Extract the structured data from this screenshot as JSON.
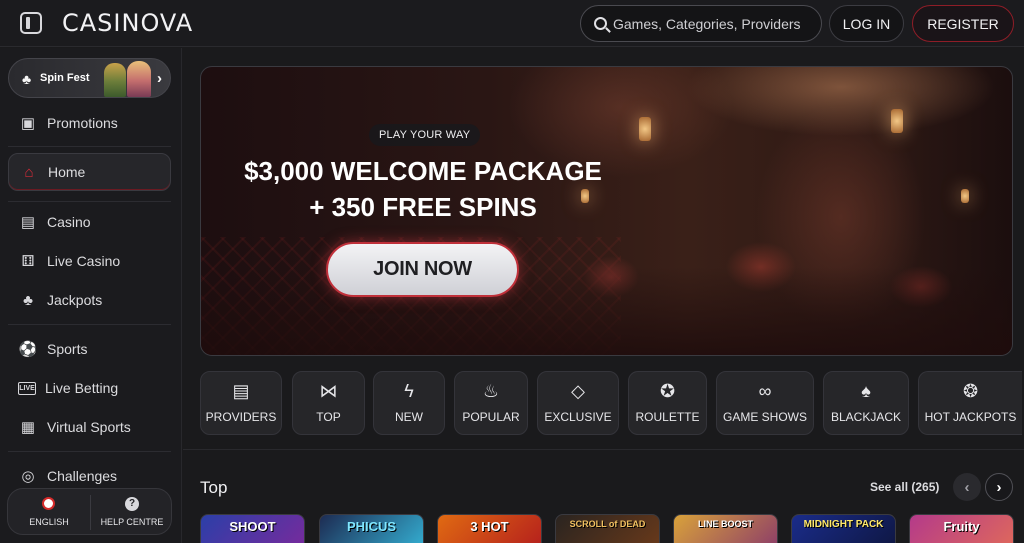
{
  "header": {
    "logo": "CASINOVA",
    "search_placeholder": "Games, Categories, Providers",
    "login_label": "LOG IN",
    "register_label": "REGISTER"
  },
  "sidebar": {
    "promo_banner_label": "Spin Fest",
    "items": [
      {
        "label": "Promotions",
        "icon": "gift-icon"
      },
      {
        "label": "Home",
        "icon": "home-icon",
        "active": true
      },
      {
        "label": "Casino",
        "icon": "slot-machine-icon"
      },
      {
        "label": "Live Casino",
        "icon": "dice-icon"
      },
      {
        "label": "Jackpots",
        "icon": "clover-icon"
      },
      {
        "label": "Sports",
        "icon": "soccer-ball-icon"
      },
      {
        "label": "Live Betting",
        "icon": "live-icon"
      },
      {
        "label": "Virtual Sports",
        "icon": "virtual-sports-icon"
      },
      {
        "label": "Challenges",
        "icon": "target-icon"
      }
    ],
    "language_label": "ENGLISH",
    "help_label": "HELP CENTRE"
  },
  "hero": {
    "tag": "PLAY YOUR WAY",
    "headline_line1": "$3,000 WELCOME PACKAGE",
    "headline_line2": "+ 350 FREE SPINS",
    "cta_label": "JOIN NOW"
  },
  "categories": [
    {
      "label": "PROVIDERS",
      "icon": "providers-icon"
    },
    {
      "label": "TOP",
      "icon": "bowtie-icon"
    },
    {
      "label": "NEW",
      "icon": "lightning-icon"
    },
    {
      "label": "POPULAR",
      "icon": "flame-icon"
    },
    {
      "label": "EXCLUSIVE",
      "icon": "diamond-icon"
    },
    {
      "label": "ROULETTE",
      "icon": "roulette-icon"
    },
    {
      "label": "GAME SHOWS",
      "icon": "mask-icon"
    },
    {
      "label": "BLACKJACK",
      "icon": "cards-icon"
    },
    {
      "label": "HOT JACKPOTS",
      "icon": "hot-jackpot-icon"
    }
  ],
  "top_section": {
    "title": "Top",
    "see_all": "See all (265)",
    "games": [
      {
        "title": "SHOOT",
        "color": "#2b3fa8"
      },
      {
        "title": "PHICUS",
        "color": "#1d2b52"
      },
      {
        "title": "3 HOT",
        "color": "#e06a12"
      },
      {
        "title": "SCROLL of DEAD",
        "color": "#2a2420"
      },
      {
        "title": "LINE BOOST",
        "color": "#d9a23a"
      },
      {
        "title": "MIDNIGHT PACK",
        "color": "#1a2c8a"
      },
      {
        "title": "Fruity",
        "color": "#b43a8a"
      }
    ]
  },
  "colors": {
    "accent": "#c0303a",
    "background": "#1a1a1c"
  }
}
